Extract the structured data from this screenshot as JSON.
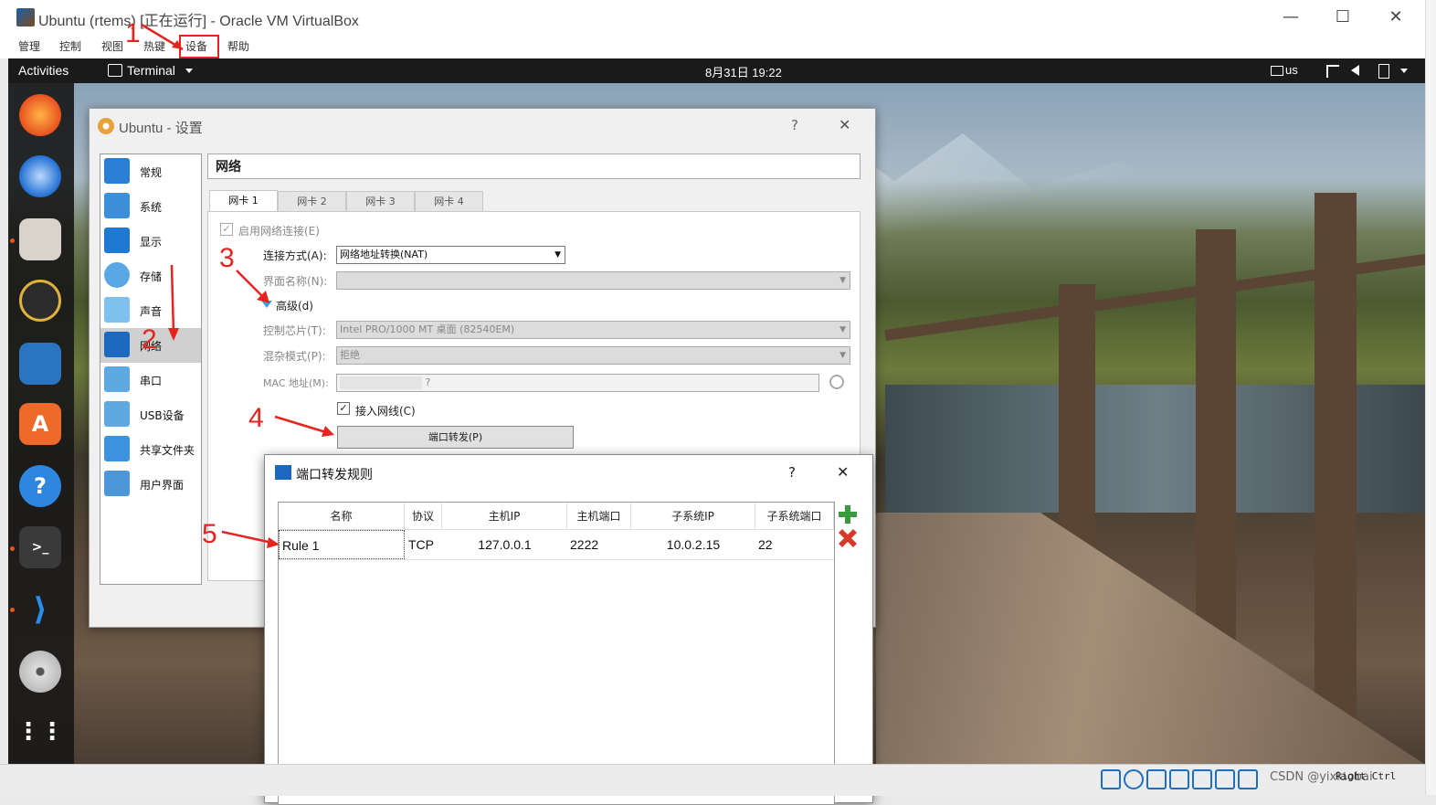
{
  "window": {
    "title": "Ubuntu (rtems) [正在运行] - Oracle VM VirtualBox",
    "minimize": "—",
    "maximize": "☐",
    "close": "✕"
  },
  "menu": [
    "管理",
    "控制",
    "视图",
    "热键",
    "设备",
    "帮助"
  ],
  "topbar": {
    "activities": "Activities",
    "app": "Terminal",
    "datetime": "8月31日  19:22",
    "keyboard": "us"
  },
  "settings": {
    "title": "Ubuntu - 设置",
    "help": "?",
    "close": "✕",
    "section_title": "网络",
    "sidebar": [
      "常规",
      "系统",
      "显示",
      "存储",
      "声音",
      "网络",
      "串口",
      "USB设备",
      "共享文件夹",
      "用户界面"
    ],
    "tabs": [
      "网卡 1",
      "网卡 2",
      "网卡 3",
      "网卡 4"
    ],
    "enable_label": "启用网络连接(E)",
    "attach_label": "连接方式(A):",
    "attach_value": "网络地址转换(NAT)",
    "name_label": "界面名称(N):",
    "advanced_label": "高级(d)",
    "adapter_label": "控制芯片(T):",
    "adapter_value": "Intel PRO/1000 MT 桌面 (82540EM)",
    "promisc_label": "混杂模式(P):",
    "promisc_value": "拒绝",
    "mac_label": "MAC 地址(M):",
    "mac_value": "?",
    "cable_label": "接入网线(C)",
    "port_forward_button": "端口转发(P)"
  },
  "port_forward": {
    "title": "端口转发规则",
    "help": "?",
    "close": "✕",
    "columns": [
      "名称",
      "协议",
      "主机IP",
      "主机端口",
      "子系统IP",
      "子系统端口"
    ],
    "rows": [
      {
        "name": "Rule 1",
        "protocol": "TCP",
        "host_ip": "127.0.0.1",
        "host_port": "2222",
        "guest_ip": "10.0.2.15",
        "guest_port": "22"
      }
    ]
  },
  "statusbar": {
    "hostkey": "Right Ctrl",
    "watermark": "CSDN @yixiaobai"
  },
  "annotations": [
    "1",
    "2",
    "3",
    "4",
    "5"
  ],
  "colors": {
    "annotation": "#e52420",
    "dock_bg": "#191919",
    "topbar_bg": "#1a1a1a"
  }
}
